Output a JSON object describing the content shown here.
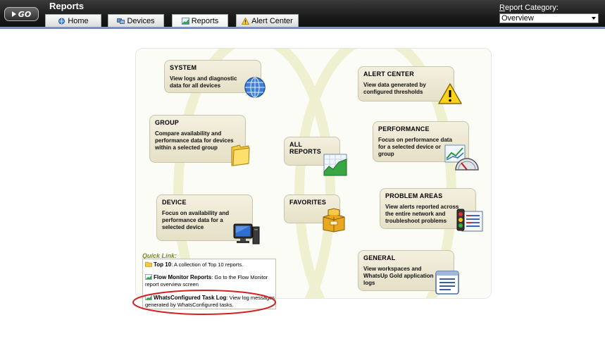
{
  "header": {
    "go_label": "GO",
    "title": "Reports",
    "tabs": [
      {
        "label": "Home",
        "icon": "home-icon",
        "active": false
      },
      {
        "label": "Devices",
        "icon": "devices-icon",
        "active": false
      },
      {
        "label": "Reports",
        "icon": "reports-icon",
        "active": true
      },
      {
        "label": "Alert Center",
        "icon": "alert-icon",
        "active": false
      }
    ],
    "category_label_first": "R",
    "category_label_rest": "eport Category:",
    "category_value": "Overview"
  },
  "cards": {
    "system": {
      "title": "SYSTEM",
      "desc": "View logs and diagnostic data for all devices"
    },
    "alert_center": {
      "title": "ALERT CENTER",
      "desc": "View data generated by configured thresholds"
    },
    "group": {
      "title": "GROUP",
      "desc": "Compare availability and performance data for devices within a selected group"
    },
    "all_reports": {
      "title": "ALL REPORTS"
    },
    "performance": {
      "title": "PERFORMANCE",
      "desc": "Focus on performance data for a selected device or group"
    },
    "device": {
      "title": "DEVICE",
      "desc": "Focus on availability and performance data for a selected device"
    },
    "favorites": {
      "title": "FAVORITES"
    },
    "problem_areas": {
      "title": "PROBLEM AREAS",
      "desc": "View alerts reported across the entire network and troubleshoot problems"
    },
    "general": {
      "title": "GENERAL",
      "desc": "View workspaces and WhatsUp Gold application logs"
    }
  },
  "quick_link": {
    "label": "Quick Link:",
    "items": [
      {
        "name": "Top 10",
        "desc": ": A collection of Top 10 reports."
      },
      {
        "name": "Flow Monitor Reports",
        "desc": ": Go to the Flow Monitor report overview screen"
      },
      {
        "name": "WhatsConfigured Task Log",
        "desc": ": View log messages generated by WhatsConfigured tasks."
      }
    ]
  },
  "colors": {
    "accent_line": "#6f8fbf",
    "card_bg": "#ece8d2",
    "quick_link_label": "#7a8a20",
    "highlight_ellipse": "#d42020"
  }
}
